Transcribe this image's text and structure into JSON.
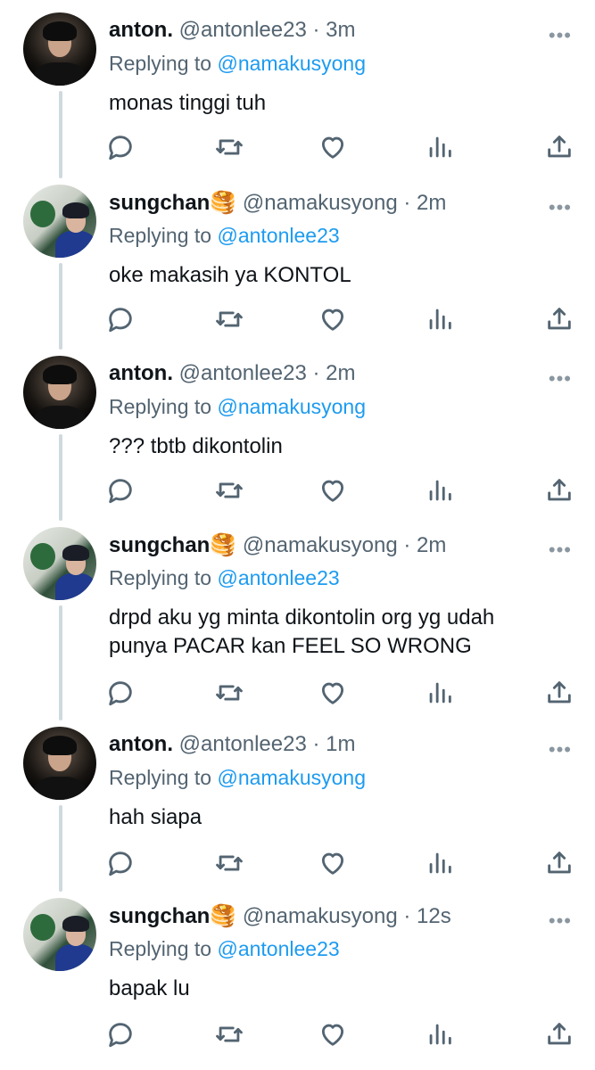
{
  "tweets": [
    {
      "name": "anton.",
      "emoji": "",
      "handle": "@antonlee23",
      "time": "3m",
      "replying_label": "Replying to",
      "replying_to": "@namakusyong",
      "text": "monas tinggi tuh",
      "avatar": "anton"
    },
    {
      "name": "sungchan",
      "emoji": "🥞",
      "handle": "@namakusyong",
      "time": "2m",
      "replying_label": "Replying to",
      "replying_to": "@antonlee23",
      "text": "oke makasih ya KONTOL",
      "avatar": "sung"
    },
    {
      "name": "anton.",
      "emoji": "",
      "handle": "@antonlee23",
      "time": "2m",
      "replying_label": "Replying to",
      "replying_to": "@namakusyong",
      "text": "??? tbtb dikontolin",
      "avatar": "anton"
    },
    {
      "name": "sungchan",
      "emoji": "🥞",
      "handle": "@namakusyong",
      "time": "2m",
      "replying_label": "Replying to",
      "replying_to": "@antonlee23",
      "text": "drpd aku yg minta dikontolin org yg udah punya PACAR kan FEEL SO WRONG",
      "avatar": "sung"
    },
    {
      "name": "anton.",
      "emoji": "",
      "handle": "@antonlee23",
      "time": "1m",
      "replying_label": "Replying to",
      "replying_to": "@namakusyong",
      "text": "hah siapa",
      "avatar": "anton"
    },
    {
      "name": "sungchan",
      "emoji": "🥞",
      "handle": "@namakusyong",
      "time": "12s",
      "replying_label": "Replying to",
      "replying_to": "@antonlee23",
      "text": "bapak lu",
      "avatar": "sung"
    }
  ],
  "separator": "·",
  "more_glyph": "•••",
  "icons": [
    "reply-icon",
    "retweet-icon",
    "like-icon",
    "views-icon",
    "share-icon"
  ],
  "colors": {
    "accent": "#1d9bf0",
    "muted": "#536471",
    "thread_line": "#cfd9de"
  }
}
